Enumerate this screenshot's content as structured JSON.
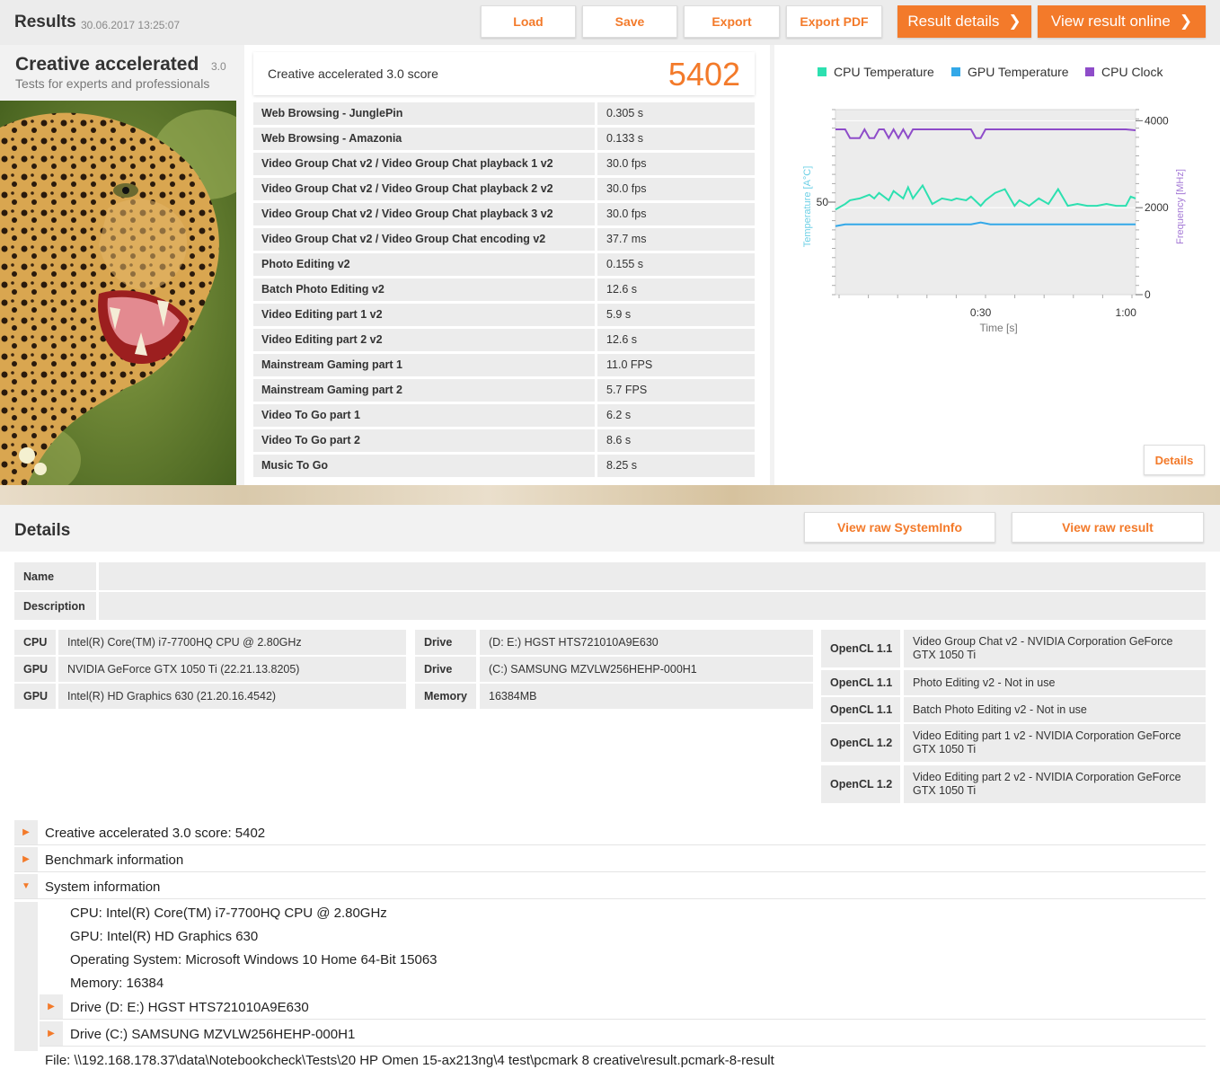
{
  "header": {
    "title": "Results",
    "date": "30.06.2017 13:25:07",
    "buttons": {
      "load": "Load",
      "save": "Save",
      "export": "Export",
      "export_pdf": "Export PDF",
      "result_details": "Result details",
      "view_online": "View result online"
    }
  },
  "benchmark": {
    "name": "Creative accelerated",
    "version": "3.0",
    "subtitle": "Tests for experts and professionals"
  },
  "score": {
    "label": "Creative accelerated 3.0 score",
    "value": "5402"
  },
  "results": [
    {
      "name": "Web Browsing - JunglePin",
      "value": "0.305 s"
    },
    {
      "name": "Web Browsing - Amazonia",
      "value": "0.133 s"
    },
    {
      "name": "Video Group Chat v2 / Video Group Chat playback 1 v2",
      "value": "30.0 fps"
    },
    {
      "name": "Video Group Chat v2 / Video Group Chat playback 2 v2",
      "value": "30.0 fps"
    },
    {
      "name": "Video Group Chat v2 / Video Group Chat playback 3 v2",
      "value": "30.0 fps"
    },
    {
      "name": "Video Group Chat v2 / Video Group Chat encoding v2",
      "value": "37.7 ms"
    },
    {
      "name": "Photo Editing v2",
      "value": "0.155 s"
    },
    {
      "name": "Batch Photo Editing v2",
      "value": "12.6 s"
    },
    {
      "name": "Video Editing part 1 v2",
      "value": "5.9 s"
    },
    {
      "name": "Video Editing part 2 v2",
      "value": "12.6 s"
    },
    {
      "name": "Mainstream Gaming part 1",
      "value": "11.0 FPS"
    },
    {
      "name": "Mainstream Gaming part 2",
      "value": "5.7 FPS"
    },
    {
      "name": "Video To Go part 1",
      "value": "6.2 s"
    },
    {
      "name": "Video To Go part 2",
      "value": "8.6 s"
    },
    {
      "name": "Music To Go",
      "value": "8.25 s"
    }
  ],
  "chart_data": {
    "type": "line",
    "xlabel": "Time [s]",
    "ylabel_left": "Temperature [A°C]",
    "ylabel_right": "Frequency [MHz]",
    "x_ticks": [
      "0:30",
      "1:00"
    ],
    "y_left_ticks": [
      "50"
    ],
    "y_right_ticks": [
      "4000",
      "2000",
      "0"
    ],
    "xlim": [
      0,
      62
    ],
    "ylim_left": [
      0,
      100
    ],
    "ylim_right": [
      0,
      4000
    ],
    "series": [
      {
        "name": "CPU Temperature",
        "color": "#2de0b0",
        "axis": "left",
        "x": [
          0,
          2,
          3,
          5,
          7,
          8,
          9,
          11,
          12,
          14,
          15,
          16,
          18,
          20,
          22,
          24,
          25,
          27,
          28,
          30,
          31,
          33,
          35,
          37,
          38,
          40,
          42,
          44,
          46,
          48,
          50,
          52,
          54,
          56,
          58,
          60,
          61,
          62
        ],
        "y": [
          46,
          49,
          51,
          52,
          54,
          52,
          55,
          51,
          56,
          52,
          58,
          52,
          59,
          49,
          52,
          51,
          52,
          51,
          53,
          48,
          51,
          55,
          57,
          48,
          51,
          48,
          52,
          49,
          57,
          48,
          49,
          48,
          48,
          49,
          48,
          48,
          53,
          52
        ]
      },
      {
        "name": "GPU Temperature",
        "color": "#33a8e8",
        "axis": "left",
        "x": [
          0,
          2,
          5,
          10,
          15,
          20,
          25,
          28,
          30,
          32,
          35,
          40,
          45,
          50,
          55,
          60,
          62
        ],
        "y": [
          37,
          38,
          38,
          38,
          38,
          38,
          38,
          38,
          39,
          38,
          38,
          38,
          38,
          38,
          38,
          38,
          38
        ]
      },
      {
        "name": "CPU Clock",
        "color": "#8e4cc9",
        "axis": "right",
        "x": [
          0,
          2,
          3,
          5,
          6,
          7,
          8,
          9,
          10,
          11,
          12,
          13,
          14,
          15,
          16,
          17,
          18,
          19,
          20,
          21,
          22,
          23,
          24,
          25,
          26,
          27,
          28,
          29,
          30,
          31,
          35,
          40,
          45,
          50,
          55,
          60,
          62
        ],
        "y": [
          3800,
          3800,
          3600,
          3600,
          3800,
          3600,
          3600,
          3800,
          3800,
          3600,
          3800,
          3600,
          3800,
          3600,
          3800,
          3800,
          3800,
          3800,
          3800,
          3800,
          3800,
          3800,
          3800,
          3800,
          3800,
          3800,
          3800,
          3600,
          3600,
          3800,
          3800,
          3800,
          3800,
          3800,
          3800,
          3800,
          3780
        ]
      }
    ]
  },
  "chart_details_button": "Details",
  "details": {
    "title": "Details",
    "btn_sysinfo": "View raw SystemInfo",
    "btn_raw": "View raw result",
    "name_label": "Name",
    "description_label": "Description",
    "hw_left": [
      {
        "k": "CPU",
        "v": "Intel(R) Core(TM) i7-7700HQ CPU @ 2.80GHz"
      },
      {
        "k": "GPU",
        "v": "NVIDIA GeForce GTX 1050 Ti (22.21.13.8205)"
      },
      {
        "k": "GPU",
        "v": "Intel(R) HD Graphics 630 (21.20.16.4542)"
      }
    ],
    "hw_mid": [
      {
        "k": "Drive",
        "v": "(D: E:) HGST HTS721010A9E630"
      },
      {
        "k": "Drive",
        "v": "(C:) SAMSUNG MZVLW256HEHP-000H1"
      },
      {
        "k": "Memory",
        "v": "16384MB"
      }
    ],
    "opencl": [
      {
        "k": "OpenCL 1.1",
        "v": "Video Group Chat v2 - NVIDIA Corporation GeForce GTX 1050 Ti"
      },
      {
        "k": "OpenCL 1.1",
        "v": "Photo Editing v2 - Not in use"
      },
      {
        "k": "OpenCL 1.1",
        "v": "Batch Photo Editing v2 - Not in use"
      },
      {
        "k": "OpenCL 1.2",
        "v": "Video Editing part 1 v2 - NVIDIA Corporation GeForce GTX 1050 Ti"
      },
      {
        "k": "OpenCL 1.2",
        "v": "Video Editing part 2 v2 - NVIDIA Corporation GeForce GTX 1050 Ti"
      }
    ],
    "tree": {
      "score": "Creative accelerated 3.0 score: 5402",
      "benchmark_info": "Benchmark information",
      "system_info": "System information",
      "sys_lines": [
        "CPU: Intel(R) Core(TM) i7-7700HQ CPU @ 2.80GHz",
        "GPU: Intel(R) HD Graphics 630",
        "Operating System: Microsoft Windows 10 Home 64-Bit 15063",
        "Memory: 16384"
      ],
      "drive1": "Drive (D: E:) HGST HTS721010A9E630",
      "drive2": "Drive (C:) SAMSUNG MZVLW256HEHP-000H1"
    },
    "file": "File: \\\\192.168.178.37\\data\\Notebookcheck\\Tests\\20 HP Omen 15-ax213ng\\4 test\\pcmark 8 creative\\result.pcmark-8-result"
  }
}
